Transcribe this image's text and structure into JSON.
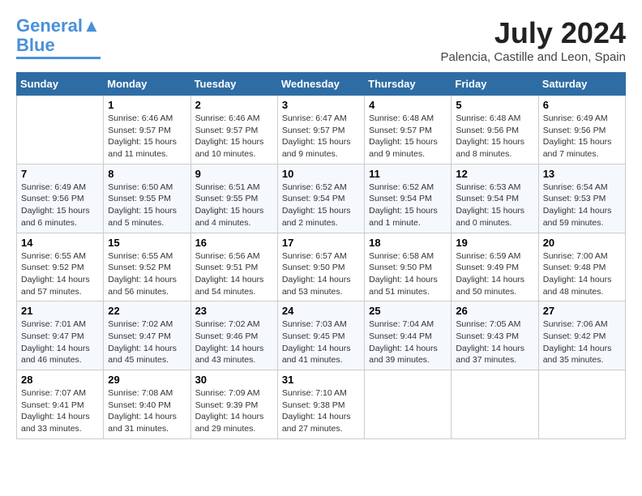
{
  "header": {
    "logo_line1": "General",
    "logo_line2": "Blue",
    "month_year": "July 2024",
    "location": "Palencia, Castille and Leon, Spain"
  },
  "days_of_week": [
    "Sunday",
    "Monday",
    "Tuesday",
    "Wednesday",
    "Thursday",
    "Friday",
    "Saturday"
  ],
  "weeks": [
    [
      {
        "day": "",
        "sunrise": "",
        "sunset": "",
        "daylight": ""
      },
      {
        "day": "1",
        "sunrise": "Sunrise: 6:46 AM",
        "sunset": "Sunset: 9:57 PM",
        "daylight": "Daylight: 15 hours and 11 minutes."
      },
      {
        "day": "2",
        "sunrise": "Sunrise: 6:46 AM",
        "sunset": "Sunset: 9:57 PM",
        "daylight": "Daylight: 15 hours and 10 minutes."
      },
      {
        "day": "3",
        "sunrise": "Sunrise: 6:47 AM",
        "sunset": "Sunset: 9:57 PM",
        "daylight": "Daylight: 15 hours and 9 minutes."
      },
      {
        "day": "4",
        "sunrise": "Sunrise: 6:48 AM",
        "sunset": "Sunset: 9:57 PM",
        "daylight": "Daylight: 15 hours and 9 minutes."
      },
      {
        "day": "5",
        "sunrise": "Sunrise: 6:48 AM",
        "sunset": "Sunset: 9:56 PM",
        "daylight": "Daylight: 15 hours and 8 minutes."
      },
      {
        "day": "6",
        "sunrise": "Sunrise: 6:49 AM",
        "sunset": "Sunset: 9:56 PM",
        "daylight": "Daylight: 15 hours and 7 minutes."
      }
    ],
    [
      {
        "day": "7",
        "sunrise": "Sunrise: 6:49 AM",
        "sunset": "Sunset: 9:56 PM",
        "daylight": "Daylight: 15 hours and 6 minutes."
      },
      {
        "day": "8",
        "sunrise": "Sunrise: 6:50 AM",
        "sunset": "Sunset: 9:55 PM",
        "daylight": "Daylight: 15 hours and 5 minutes."
      },
      {
        "day": "9",
        "sunrise": "Sunrise: 6:51 AM",
        "sunset": "Sunset: 9:55 PM",
        "daylight": "Daylight: 15 hours and 4 minutes."
      },
      {
        "day": "10",
        "sunrise": "Sunrise: 6:52 AM",
        "sunset": "Sunset: 9:54 PM",
        "daylight": "Daylight: 15 hours and 2 minutes."
      },
      {
        "day": "11",
        "sunrise": "Sunrise: 6:52 AM",
        "sunset": "Sunset: 9:54 PM",
        "daylight": "Daylight: 15 hours and 1 minute."
      },
      {
        "day": "12",
        "sunrise": "Sunrise: 6:53 AM",
        "sunset": "Sunset: 9:54 PM",
        "daylight": "Daylight: 15 hours and 0 minutes."
      },
      {
        "day": "13",
        "sunrise": "Sunrise: 6:54 AM",
        "sunset": "Sunset: 9:53 PM",
        "daylight": "Daylight: 14 hours and 59 minutes."
      }
    ],
    [
      {
        "day": "14",
        "sunrise": "Sunrise: 6:55 AM",
        "sunset": "Sunset: 9:52 PM",
        "daylight": "Daylight: 14 hours and 57 minutes."
      },
      {
        "day": "15",
        "sunrise": "Sunrise: 6:55 AM",
        "sunset": "Sunset: 9:52 PM",
        "daylight": "Daylight: 14 hours and 56 minutes."
      },
      {
        "day": "16",
        "sunrise": "Sunrise: 6:56 AM",
        "sunset": "Sunset: 9:51 PM",
        "daylight": "Daylight: 14 hours and 54 minutes."
      },
      {
        "day": "17",
        "sunrise": "Sunrise: 6:57 AM",
        "sunset": "Sunset: 9:50 PM",
        "daylight": "Daylight: 14 hours and 53 minutes."
      },
      {
        "day": "18",
        "sunrise": "Sunrise: 6:58 AM",
        "sunset": "Sunset: 9:50 PM",
        "daylight": "Daylight: 14 hours and 51 minutes."
      },
      {
        "day": "19",
        "sunrise": "Sunrise: 6:59 AM",
        "sunset": "Sunset: 9:49 PM",
        "daylight": "Daylight: 14 hours and 50 minutes."
      },
      {
        "day": "20",
        "sunrise": "Sunrise: 7:00 AM",
        "sunset": "Sunset: 9:48 PM",
        "daylight": "Daylight: 14 hours and 48 minutes."
      }
    ],
    [
      {
        "day": "21",
        "sunrise": "Sunrise: 7:01 AM",
        "sunset": "Sunset: 9:47 PM",
        "daylight": "Daylight: 14 hours and 46 minutes."
      },
      {
        "day": "22",
        "sunrise": "Sunrise: 7:02 AM",
        "sunset": "Sunset: 9:47 PM",
        "daylight": "Daylight: 14 hours and 45 minutes."
      },
      {
        "day": "23",
        "sunrise": "Sunrise: 7:02 AM",
        "sunset": "Sunset: 9:46 PM",
        "daylight": "Daylight: 14 hours and 43 minutes."
      },
      {
        "day": "24",
        "sunrise": "Sunrise: 7:03 AM",
        "sunset": "Sunset: 9:45 PM",
        "daylight": "Daylight: 14 hours and 41 minutes."
      },
      {
        "day": "25",
        "sunrise": "Sunrise: 7:04 AM",
        "sunset": "Sunset: 9:44 PM",
        "daylight": "Daylight: 14 hours and 39 minutes."
      },
      {
        "day": "26",
        "sunrise": "Sunrise: 7:05 AM",
        "sunset": "Sunset: 9:43 PM",
        "daylight": "Daylight: 14 hours and 37 minutes."
      },
      {
        "day": "27",
        "sunrise": "Sunrise: 7:06 AM",
        "sunset": "Sunset: 9:42 PM",
        "daylight": "Daylight: 14 hours and 35 minutes."
      }
    ],
    [
      {
        "day": "28",
        "sunrise": "Sunrise: 7:07 AM",
        "sunset": "Sunset: 9:41 PM",
        "daylight": "Daylight: 14 hours and 33 minutes."
      },
      {
        "day": "29",
        "sunrise": "Sunrise: 7:08 AM",
        "sunset": "Sunset: 9:40 PM",
        "daylight": "Daylight: 14 hours and 31 minutes."
      },
      {
        "day": "30",
        "sunrise": "Sunrise: 7:09 AM",
        "sunset": "Sunset: 9:39 PM",
        "daylight": "Daylight: 14 hours and 29 minutes."
      },
      {
        "day": "31",
        "sunrise": "Sunrise: 7:10 AM",
        "sunset": "Sunset: 9:38 PM",
        "daylight": "Daylight: 14 hours and 27 minutes."
      },
      {
        "day": "",
        "sunrise": "",
        "sunset": "",
        "daylight": ""
      },
      {
        "day": "",
        "sunrise": "",
        "sunset": "",
        "daylight": ""
      },
      {
        "day": "",
        "sunrise": "",
        "sunset": "",
        "daylight": ""
      }
    ]
  ]
}
